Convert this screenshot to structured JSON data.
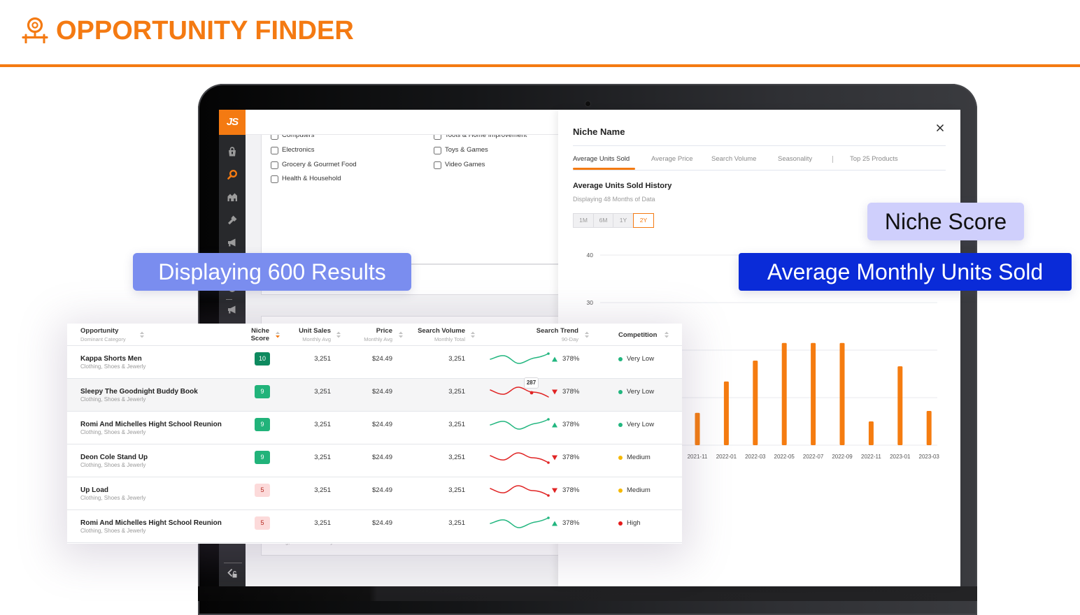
{
  "header": {
    "title": "OPPORTUNITY FINDER",
    "icon": "webcam-target-icon"
  },
  "theme": {
    "brand_orange": "#F47A12",
    "bar_color": "#F57C10",
    "trend_up_color": "#22B67F",
    "trend_down_color": "#E02424",
    "competition_colors": {
      "Very Low": "#22B67F",
      "Medium": "#F5B800",
      "High": "#E51B1B"
    },
    "score_badge_styles": {
      "10": {
        "bg": "#0E8A5F",
        "fg": "#FFFFFF"
      },
      "9": {
        "bg": "#21B37A",
        "fg": "#FFFFFF"
      },
      "5": {
        "bg": "#FCDADA",
        "fg": "#B3261E"
      }
    }
  },
  "app": {
    "logo_text": "JS",
    "sidebar_items": [
      {
        "icon": "bag-icon",
        "active": false
      },
      {
        "icon": "search-icon",
        "active": true
      },
      {
        "icon": "warehouse-icon",
        "active": false
      },
      {
        "icon": "key-icon",
        "active": false
      },
      {
        "icon": "megaphone-icon",
        "active": false
      },
      {
        "icon": "megaphone-icon",
        "active": false
      }
    ],
    "sidebar_footer_icon": "collapse-lock-icon",
    "category_filters": [
      [
        {
          "label": "Computers",
          "checked": false
        },
        {
          "label": "Electronics",
          "checked": false
        },
        {
          "label": "Grocery & Gourmet Food",
          "checked": false
        },
        {
          "label": "Health & Household",
          "checked": false
        }
      ],
      [
        {
          "label": "Tools & Home Improvement",
          "checked": false
        },
        {
          "label": "Toys & Games",
          "checked": false
        },
        {
          "label": "Video Games",
          "checked": false
        }
      ]
    ],
    "background_row_category": "Clothing, Shoes & Jewerly"
  },
  "niche_panel": {
    "title": "Niche Name",
    "tabs": [
      {
        "label": "Average Units Sold",
        "active": true
      },
      {
        "label": "Average Price",
        "active": false
      },
      {
        "label": "Search Volume",
        "active": false
      },
      {
        "label": "Seasonality",
        "active": false
      },
      {
        "label": "Top 25 Products",
        "active": false
      }
    ],
    "section_title": "Average Units Sold History",
    "section_subtitle": "Displaying 48 Months of Data",
    "ranges": [
      {
        "label": "1M",
        "active": false
      },
      {
        "label": "6M",
        "active": false
      },
      {
        "label": "1Y",
        "active": false
      },
      {
        "label": "2Y",
        "active": true
      }
    ]
  },
  "chart_data": {
    "type": "bar",
    "title": "Average Units Sold History",
    "subtitle": "Displaying 48 Months of Data",
    "categories": [
      "2021-11",
      "2022-01",
      "2022-03",
      "2022-05",
      "2022-07",
      "2022-09",
      "2022-11",
      "2023-01",
      "2023-03"
    ],
    "values": [
      6.8,
      13.4,
      17.8,
      21.5,
      21.5,
      21.5,
      5.0,
      16.6,
      7.2
    ],
    "xlabel": "",
    "ylabel": "",
    "ylim": [
      0,
      40
    ],
    "ytick_labels": [
      40,
      30
    ],
    "gridlines": [
      0,
      10,
      20,
      30,
      40
    ],
    "grid": true,
    "legend": "none"
  },
  "table": {
    "columns": [
      {
        "key": "name",
        "title": "Opportunity",
        "subtitle": "Dominant Category"
      },
      {
        "key": "niche_score",
        "title": "Niche",
        "title2": "Score",
        "sorted": "desc"
      },
      {
        "key": "unit_sales",
        "title": "Unit Sales",
        "subtitle": "Monthly Avg"
      },
      {
        "key": "price",
        "title": "Price",
        "subtitle": "Monthly Avg"
      },
      {
        "key": "search_volume",
        "title": "Search Volume",
        "subtitle": "Monthly Total"
      },
      {
        "key": "search_trend",
        "title": "Search Trend",
        "subtitle": "90-Day"
      },
      {
        "key": "competition",
        "title": "Competition"
      }
    ],
    "rows": [
      {
        "name": "Kappa Shorts Men",
        "category": "Clothing, Shoes & Jewerly",
        "niche_score": "10",
        "unit_sales": "3,251",
        "price": "$24.49",
        "search_volume": "3,251",
        "trend": "up",
        "trend_pct": "378%",
        "competition": "Very Low"
      },
      {
        "name": "Sleepy The Goodnight Buddy Book",
        "category": "Clothing, Shoes & Jewerly",
        "niche_score": "9",
        "unit_sales": "3,251",
        "price": "$24.49",
        "search_volume": "3,251",
        "trend": "down",
        "trend_pct": "378%",
        "competition": "Very Low",
        "highlighted": true,
        "tooltip": "287"
      },
      {
        "name": "Romi And Michelles Hight School Reunion",
        "category": "Clothing, Shoes & Jewerly",
        "niche_score": "9",
        "unit_sales": "3,251",
        "price": "$24.49",
        "search_volume": "3,251",
        "trend": "up",
        "trend_pct": "378%",
        "competition": "Very Low"
      },
      {
        "name": "Deon Cole Stand Up",
        "category": "Clothing, Shoes & Jewerly",
        "niche_score": "9",
        "unit_sales": "3,251",
        "price": "$24.49",
        "search_volume": "3,251",
        "trend": "down",
        "trend_pct": "378%",
        "competition": "Medium"
      },
      {
        "name": "Up Load",
        "category": "Clothing, Shoes & Jewerly",
        "niche_score": "5",
        "unit_sales": "3,251",
        "price": "$24.49",
        "search_volume": "3,251",
        "trend": "down",
        "trend_pct": "378%",
        "competition": "Medium"
      },
      {
        "name": "Romi And Michelles Hight School Reunion",
        "category": "Clothing, Shoes & Jewerly",
        "niche_score": "5",
        "unit_sales": "3,251",
        "price": "$24.49",
        "search_volume": "3,251",
        "trend": "up",
        "trend_pct": "378%",
        "competition": "High"
      }
    ]
  },
  "annotations": {
    "results_count": "Displaying 600 Results",
    "niche_score": "Niche Score",
    "avg_monthly_units": "Average Monthly Units Sold"
  }
}
